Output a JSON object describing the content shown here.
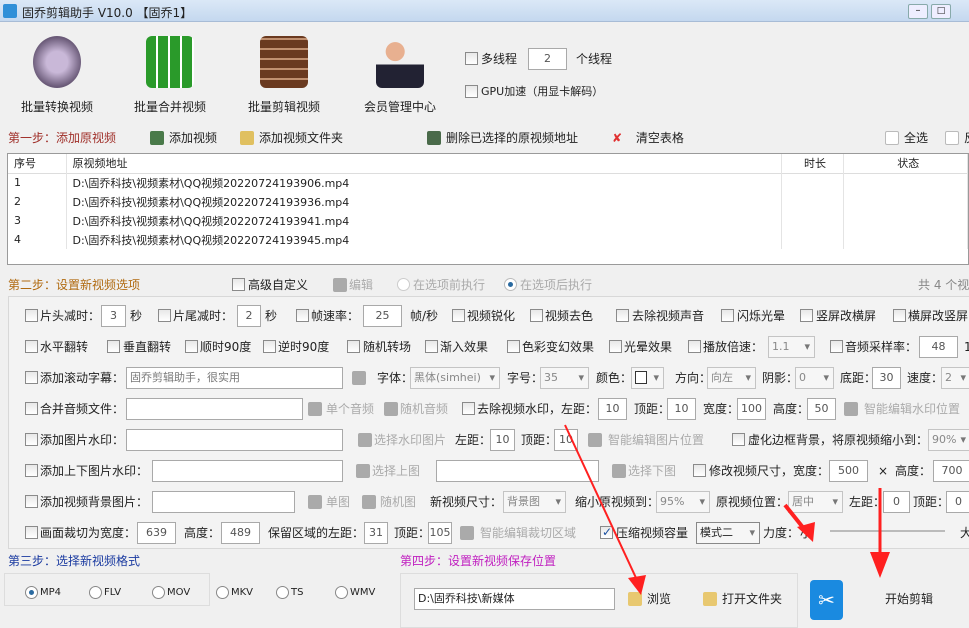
{
  "window": {
    "title": "固乔剪辑助手 V10.0  【固乔1】"
  },
  "toolbar": {
    "items": [
      {
        "label": "批量转换视频"
      },
      {
        "label": "批量合并视频"
      },
      {
        "label": "批量剪辑视频"
      },
      {
        "label": "会员管理中心"
      }
    ],
    "multithread_label": "多线程",
    "thread_count": "2",
    "thread_unit": "个线程",
    "gpu_label": "GPU加速（用显卡解码）"
  },
  "step1": {
    "label": "第一步：添加原视频",
    "add_video": "添加视频",
    "add_folder": "添加视频文件夹",
    "delete_selected": "删除已选择的原视频地址",
    "clear_table": "清空表格",
    "select_all": "全选",
    "invert": "反"
  },
  "table": {
    "headers": [
      "序号",
      "原视频地址",
      "时长",
      "状态"
    ],
    "rows": [
      {
        "no": "1",
        "path": "D:\\固乔科技\\视频素材\\QQ视频20220724193906.mp4",
        "duration": "",
        "status": ""
      },
      {
        "no": "2",
        "path": "D:\\固乔科技\\视频素材\\QQ视频20220724193936.mp4",
        "duration": "",
        "status": ""
      },
      {
        "no": "3",
        "path": "D:\\固乔科技\\视频素材\\QQ视频20220724193941.mp4",
        "duration": "",
        "status": ""
      },
      {
        "no": "4",
        "path": "D:\\固乔科技\\视频素材\\QQ视频20220724193945.mp4",
        "duration": "",
        "status": ""
      }
    ]
  },
  "step2": {
    "label": "第二步：设置新视频选项",
    "advanced": "高级自定义",
    "edit": "编辑",
    "before": "在选项前执行",
    "after": "在选项后执行",
    "count": "共 4 个视",
    "r1": {
      "head": "片头减时：",
      "head_v": "3",
      "sec": "秒",
      "tail": "片尾减时：",
      "tail_v": "2",
      "sec2": "秒",
      "fps": "帧速率：",
      "fps_v": "25",
      "fps_unit": "帧/秒",
      "sharpen": "视频锐化",
      "decolor": "视频去色",
      "mute": "去除视频声音",
      "flash": "闪烁光晕",
      "v2h": "竖屏改横屏",
      "h2v": "横屏改竖屏"
    },
    "r2": {
      "hflip": "水平翻转",
      "vflip": "垂直翻转",
      "cw": "顺时90度",
      "ccw": "逆时90度",
      "trans": "随机转场",
      "fadein": "渐入效果",
      "color": "色彩变幻效果",
      "halo": "光晕效果",
      "speed": "播放倍速：",
      "speed_v": "1.1",
      "sample": "音频采样率：",
      "sample_v": "48",
      "trail": "1"
    },
    "r3": {
      "sub": "添加滚动字幕：",
      "sub_v": "固乔剪辑助手，很实用",
      "font": "字体：",
      "font_v": "黑体(simhei)",
      "size": "字号：",
      "size_v": "35",
      "color": "颜色：",
      "dir": "方向：",
      "dir_v": "向左",
      "shadow": "阴影：",
      "shadow_v": "0",
      "bottom": "底距：",
      "bottom_v": "30",
      "speed": "速度：",
      "speed_v": "2"
    },
    "r4": {
      "audio": "合并音频文件：",
      "single": "单个音频",
      "random": "随机音频",
      "rmwm": "去除视频水印，左距：",
      "left_v": "10",
      "top": "顶距：",
      "top_v": "10",
      "w": "宽度：",
      "w_v": "100",
      "h": "高度：",
      "h_v": "50",
      "smart": "智能编辑水印位置"
    },
    "r5": {
      "img": "添加图片水印：",
      "choose": "选择水印图片",
      "left": "左距：",
      "left_v": "10",
      "top": "顶距：",
      "top_v": "10",
      "smart": "智能编辑图片位置",
      "blur": "虚化边框背景，将原视频缩小到：",
      "blur_v": "90%"
    },
    "r6": {
      "tb": "添加上下图片水印：",
      "up": "选择上图",
      "down": "选择下图",
      "resize": "修改视频尺寸，宽度：",
      "w_v": "500",
      "x": "×",
      "h": "高度：",
      "h_v": "700"
    },
    "r7": {
      "bg": "添加视频背景图片：",
      "single": "单图",
      "random": "随机图",
      "size": "新视频尺寸：",
      "size_v": "背景图",
      "shrink": "缩小原视频到：",
      "shrink_v": "95%",
      "pos": "原视频位置：",
      "pos_v": "居中",
      "left": "左距：",
      "left_v": "0",
      "top": "顶距：",
      "top_v": "0"
    },
    "r8": {
      "crop": "画面裁切为宽度：",
      "w_v": "639",
      "h": "高度：",
      "h_v": "489",
      "left": "保留区域的左距：",
      "left_v": "31",
      "top": "顶距：",
      "top_v": "105",
      "smart": "智能编辑裁切区域",
      "compress": "压缩视频容量",
      "mode_v": "模式二",
      "force": "力度：",
      "small": "小",
      "large": "大"
    }
  },
  "step3": {
    "label": "第三步：选择新视频格式",
    "formats": [
      "MP4",
      "FLV",
      "MOV",
      "MKV",
      "TS",
      "WMV"
    ],
    "selected": "MP4"
  },
  "step4": {
    "label": "第四步：设置新视频保存位置",
    "path": "D:\\固乔科技\\新媒体",
    "browse": "浏览",
    "open_folder": "打开文件夹"
  },
  "start": {
    "label": "开始剪辑"
  },
  "colors": {
    "step1": "#a0302a",
    "step2": "#b06a10",
    "step3": "#1a3aa0",
    "step4": "#c020c0",
    "arrow": "#ff2020"
  }
}
